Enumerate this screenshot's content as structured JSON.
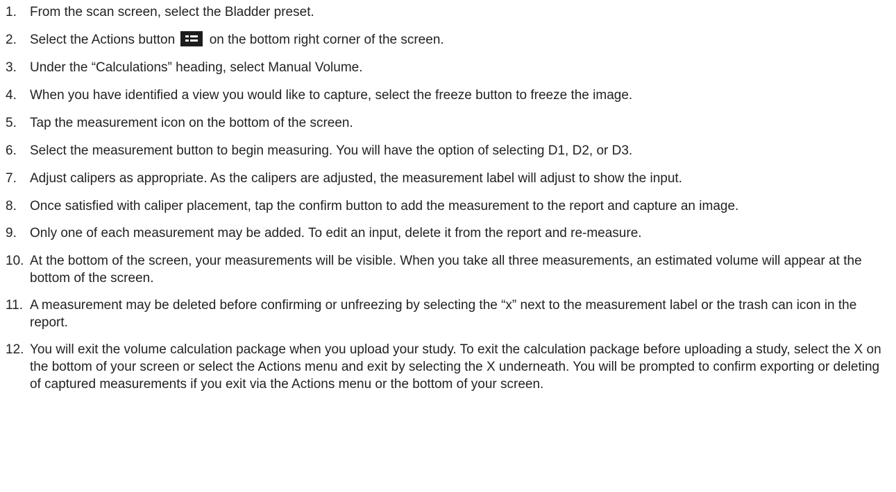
{
  "steps": [
    {
      "number": "1.",
      "text": "From the scan screen, select the Bladder preset."
    },
    {
      "number": "2.",
      "before": "Select the Actions button",
      "icon": "actions-menu-icon",
      "after": "on the bottom right corner of the screen."
    },
    {
      "number": "3.",
      "text": "Under the “Calculations” heading, select Manual Volume."
    },
    {
      "number": "4.",
      "text": "When you have identified a view you would like to capture, select the freeze button to freeze the image."
    },
    {
      "number": "5.",
      "text": "Tap the measurement icon on the bottom of the screen."
    },
    {
      "number": "6.",
      "text": "Select the measurement button to begin measuring. You will have the option of selecting D1, D2, or D3."
    },
    {
      "number": "7.",
      "text": "Adjust calipers as appropriate. As the calipers are adjusted, the measurement label will adjust to show the input."
    },
    {
      "number": "8.",
      "text": "Once satisfied with caliper placement, tap the confirm button to add the measurement to the report and capture an image."
    },
    {
      "number": "9.",
      "text": "Only one of each measurement may be added. To edit an input, delete it from the report and re-measure."
    },
    {
      "number": "10.",
      "text": "At the bottom of the screen, your measurements will be visible. When you take all three measurements, an estimated volume will appear at the bottom of the screen."
    },
    {
      "number": "11.",
      "text": "A measurement may be deleted before confirming or unfreezing by selecting the “x” next to the measurement label or the trash can icon in the report."
    },
    {
      "number": "12.",
      "text": "You will exit the volume calculation package when you upload your study. To exit the calculation package before uploading a study, select the X on the bottom of your screen or select the Actions menu and exit by selecting the X underneath. You will be prompted to confirm exporting or deleting of captured measurements if you exit via the Actions menu or the bottom of your screen."
    }
  ]
}
